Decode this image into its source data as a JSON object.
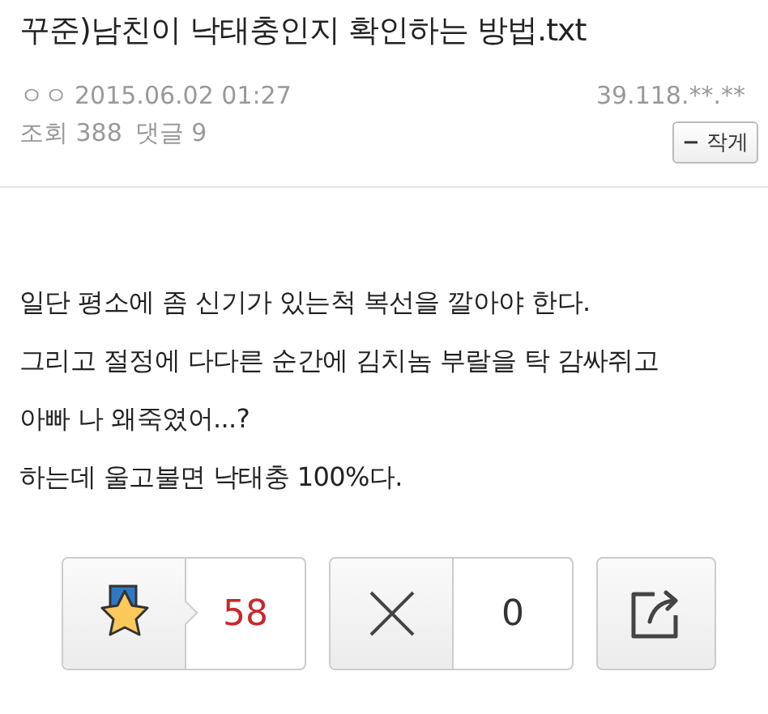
{
  "post": {
    "title": "꾸준)남친이 낙태충인지 확인하는 방법.txt",
    "author": "ㅇㅇ",
    "date": "2015.06.02 01:27",
    "ip": "39.118.**.**",
    "views_label": "조회",
    "views": "388",
    "comments_label": "댓글",
    "comments": "9",
    "shrink_button": {
      "icon": "−",
      "label": "작게"
    }
  },
  "body": [
    "일단 평소에 좀 신기가 있는척 복선을 깔아야 한다.",
    "그리고 절정에 다다른 순간에 김치놈 부랄을 탁 감싸쥐고",
    "아빠 나 왜죽였어...?",
    "하는데 울고불면 낙태충 100%다."
  ],
  "actions": [
    {
      "kind": "recommend",
      "count": "58"
    },
    {
      "kind": "dislike",
      "count": "0"
    },
    {
      "kind": "share"
    }
  ]
}
